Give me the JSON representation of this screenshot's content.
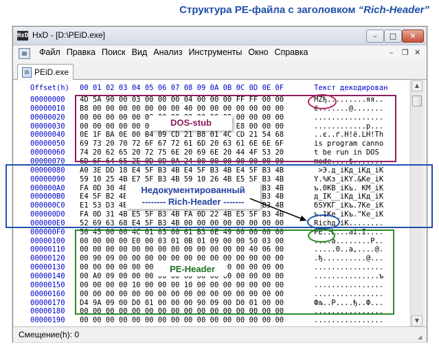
{
  "caption": {
    "prefix": "Структура PE-файла с заголовком ",
    "italic": "“Rich-Header”"
  },
  "window": {
    "icon": "HxD",
    "title": "HxD - [D:\\PEiD.exe]",
    "minimize": "–",
    "maximize": "□",
    "close": "✕"
  },
  "menu": {
    "items": [
      "Файл",
      "Правка",
      "Поиск",
      "Вид",
      "Анализ",
      "Инструменты",
      "Окно",
      "Справка"
    ],
    "mdi": [
      "–",
      "❐",
      "✕"
    ]
  },
  "tab": {
    "label": "PEiD.exe"
  },
  "editor": {
    "offset_header": "Offset(h)",
    "hex_header": "00 01 02 03 04 05 06 07 08 09 0A 0B 0C 0D 0E 0F",
    "text_header": "Текст декодирован",
    "rows": [
      {
        "off": "00000000",
        "hex": "4D 5A 90 00 03 00 00 00 04 00 00 00 FF FF 00 00",
        "txt": "MZђ.........яя.."
      },
      {
        "off": "00000010",
        "hex": "B8 00 00 00 00 00 00 00 40 00 00 00 00 00 00 00",
        "txt": "ё.......@......."
      },
      {
        "off": "00000020",
        "hex": "00 00 00 00 00 00 00 00 00 00 00 00 00 00 00 00",
        "txt": "................"
      },
      {
        "off": "00000030",
        "hex": "00 00 00 00 00 00 00 00 00 00 00 00 E8 00 00 00",
        "txt": "............p..."
      },
      {
        "off": "00000040",
        "hex": "0E 1F BA 0E 00 B4 09 CD 21 B8 01 4C CD 21 54 68",
        "txt": "..є..ґ.Н!ё.LН!Th"
      },
      {
        "off": "00000050",
        "hex": "69 73 20 70 72 6F 67 72 61 6D 20 63 61 6E 6E 6F",
        "txt": "is program canno"
      },
      {
        "off": "00000060",
        "hex": "74 20 62 65 20 72 75 6E 20 69 6E 20 44 4F 53 20",
        "txt": "t be run in DOS "
      },
      {
        "off": "00000070",
        "hex": "6D 6F 64 65 2E 0D 0D 0A 24 00 00 00 00 00 00 00",
        "txt": "mode....$......."
      },
      {
        "off": "00000080",
        "hex": "A0 3E DD 18 E4 5F B3 4B E4 5F B3 4B E4 5F B3 4B",
        "txt": " >Э.д_іKд_іKд_іK"
      },
      {
        "off": "00000090",
        "hex": "59 10 25 4B E7 5F B3 4B 59 10 26 4B E5 5F B3 4B",
        "txt": "Y.%Kз_іKY.&Kе_іK"
      },
      {
        "off": "000000A0",
        "hex": "FA 0D 30 4B C2 5F B3 4B FA 0D 20 4B CC 5F B3 4B",
        "txt": "ъ.0KВ_іKъ. KМ_іK"
      },
      {
        "off": "000000B0",
        "hex": "E4 5F B2 4B 5F 5F B3 4B E4 5F B3 4B E4 5F B3 4B",
        "txt": "д_ІK__іKд_іKд_іK"
      },
      {
        "off": "000000C0",
        "hex": "E1 53 D3 4B C3 5F B3 4B FA 0D 37 4B E5 5F B3 4B",
        "txt": "бSУKГ_іKъ.7Kе_іK"
      },
      {
        "off": "000000D0",
        "hex": "FA 0D 31 4B E5 5F B3 4B FA 0D 22 4B E5 5F B3 4B",
        "txt": "ъ.1Kе_іKъ.\"Kе_іK"
      },
      {
        "off": "000000E0",
        "hex": "52 69 63 68 E4 5F B3 4B 00 00 00 00 00 00 00 00",
        "txt": "Richд_іK........"
      },
      {
        "off": "000000F0",
        "hex": "50 45 00 00 4C 01 03 00 61 B3 0E 49 00 00 00 00",
        "txt": "PE..L...aі.I...."
      },
      {
        "off": "00000100",
        "hex": "00 00 00 00 E0 00 03 01 0B 01 09 00 00 50 03 00",
        "txt": "....а........P.."
      },
      {
        "off": "00000110",
        "hex": "00 00 00 00 00 00 00 00 00 00 00 00 00 40 06 00",
        "txt": ".....0..a,....@."
      },
      {
        "off": "00000120",
        "hex": "00 90 09 00 00 00 00 00 00 00 00 00 00 00 00 00",
        "txt": ".ђ..........@..."
      },
      {
        "off": "00000130",
        "hex": "00 00 00 00 00 00 00 00 00 00 00 00 00 00 00 00",
        "txt": "................"
      },
      {
        "off": "00000140",
        "hex": "00 A0 09 00 00 00 00 00 00 00 00 00 00 00 00 00",
        "txt": "...............ъ"
      },
      {
        "off": "00000150",
        "hex": "00 00 00 00 10 00 00 00 10 00 00 00 00 00 00 00",
        "txt": "................"
      },
      {
        "off": "00000160",
        "hex": "00 00 00 00 00 00 00 00 00 00 00 00 00 00 00 00",
        "txt": "................"
      },
      {
        "off": "00000170",
        "hex": "D4 9A 09 00 D0 01 00 00 00 90 09 00 D0 01 00 00",
        "txt": "Фљ..Р....ђ..Ф..."
      },
      {
        "off": "00000180",
        "hex": "00 00 00 00 00 00 00 00 00 00 00 00 00 00 00 00",
        "txt": "................"
      },
      {
        "off": "00000190",
        "hex": "00 00 00 00 00 00 00 00 00 00 00 00 00 00 00 00",
        "txt": "................"
      }
    ]
  },
  "annotations": {
    "dos_stub": "DOS-stub",
    "rich_line1": "Недокументированный",
    "rich_line2": "-------- Rich-Header -------",
    "pe_header": "PE-Header"
  },
  "colors": {
    "dos_stub": "#8e1c5b",
    "rich_header": "#2050b0",
    "pe_header": "#2a8a2a",
    "offset_blue": "#0000cc"
  },
  "status": {
    "text": "Смещение(h): 0"
  }
}
